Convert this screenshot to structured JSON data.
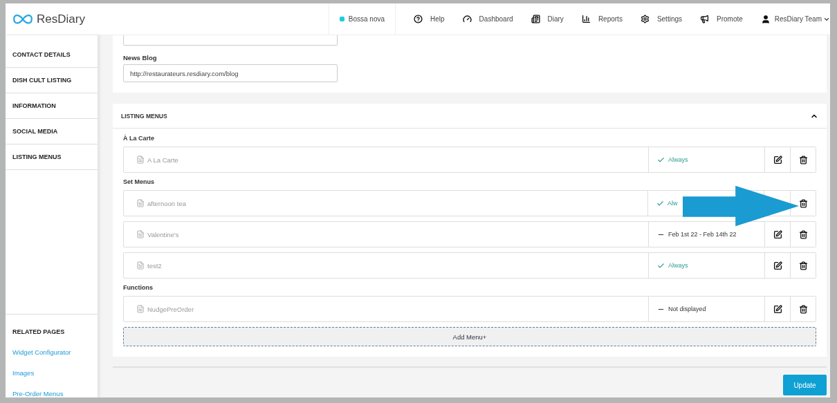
{
  "brand": {
    "name": "ResDiary"
  },
  "header": {
    "restaurant": {
      "name": "Bossa nova",
      "color": "#1ecbe1"
    },
    "nav": [
      {
        "label": "Help"
      },
      {
        "label": "Dashboard"
      },
      {
        "label": "Diary"
      },
      {
        "label": "Reports"
      },
      {
        "label": "Settings"
      },
      {
        "label": "Promote"
      }
    ],
    "user": "ResDiary Team"
  },
  "sidebar": {
    "items": [
      "CONTACT DETAILS",
      "DISH CULT LISTING",
      "INFORMATION",
      "SOCIAL MEDIA",
      "LISTING MENUS"
    ],
    "related_title": "RELATED PAGES",
    "related_links": [
      "Widget Configurator",
      "Images",
      "Pre-Order Menus"
    ]
  },
  "links_card": {
    "field_label": "News Blog",
    "field_value": "http://restaurateurs.resdiary.com/blog"
  },
  "listing_menus": {
    "title": "LISTING MENUS",
    "expanded": true,
    "groups": [
      {
        "title": "À La Carte",
        "menus": [
          {
            "name": "A La Carte",
            "status": "Always",
            "kind": "always",
            "edit": true
          }
        ]
      },
      {
        "title": "Set Menus",
        "menus": [
          {
            "name": "afternoon tea",
            "status": "Alw",
            "kind": "always",
            "edit": false
          },
          {
            "name": "Valentine's",
            "status": "Feb 1st 22 - Feb 14th 22",
            "kind": "dated",
            "edit": true
          },
          {
            "name": "test2",
            "status": "Always",
            "kind": "always",
            "edit": true
          }
        ]
      },
      {
        "title": "Functions",
        "menus": [
          {
            "name": "NudgePreOrder",
            "status": "Not displayed",
            "kind": "hidden",
            "edit": true
          }
        ]
      }
    ],
    "add_button": "Add Menu+"
  },
  "update_button": "Update"
}
